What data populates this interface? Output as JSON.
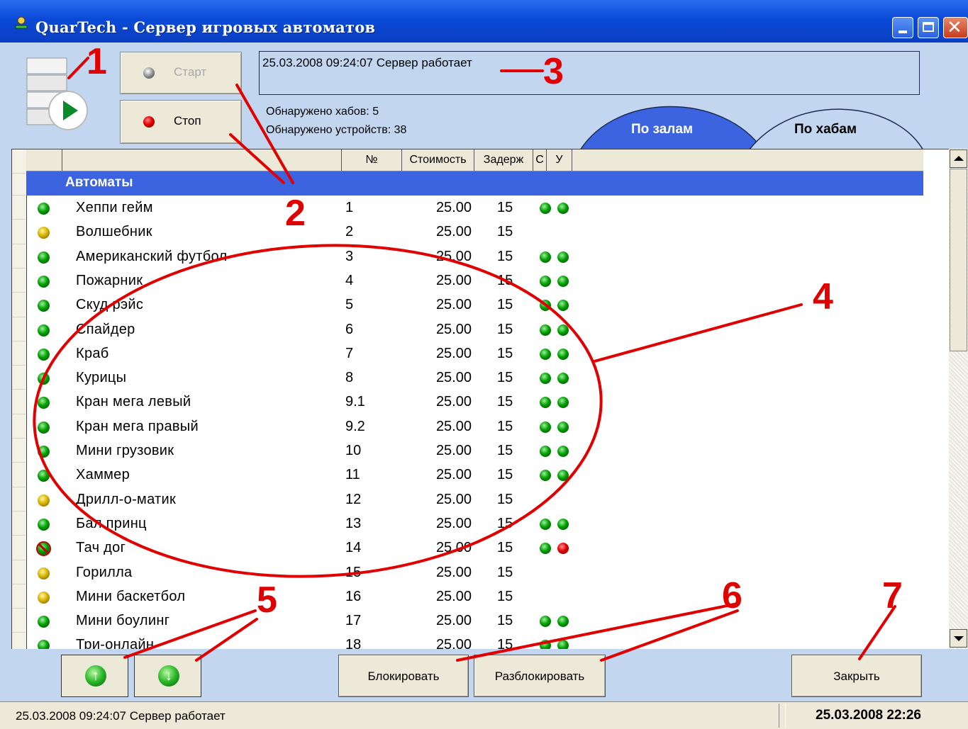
{
  "window": {
    "title": "QuarTech - Сервер игровых автоматов"
  },
  "controls": {
    "start_label": "Старт",
    "stop_label": "Стоп"
  },
  "status": {
    "message": "25.03.2008 09:24:07  Сервер работает"
  },
  "info": {
    "hubs_found": "Обнаружено хабов: 5",
    "devices_found": "Обнаружено устройств: 38"
  },
  "tabs": {
    "halls": "По залам",
    "hubs": "По хабам"
  },
  "table": {
    "headers": {
      "number": "№",
      "cost": "Стоимость",
      "delay": "Задерж",
      "c": "С",
      "u": "У"
    },
    "group": "Автоматы",
    "rows": [
      {
        "status": "green",
        "name": "Хеппи гейм",
        "number": "1",
        "cost": "25.00",
        "delay": "15",
        "c": "ok",
        "u": "ok"
      },
      {
        "status": "yellow",
        "name": "Волшебник",
        "number": "2",
        "cost": "25.00",
        "delay": "15",
        "c": "",
        "u": ""
      },
      {
        "status": "green",
        "name": "Американский футбол",
        "number": "3",
        "cost": "25.00",
        "delay": "15",
        "c": "ok",
        "u": "ok"
      },
      {
        "status": "green",
        "name": "Пожарник",
        "number": "4",
        "cost": "25.00",
        "delay": "15",
        "c": "ok",
        "u": "ok"
      },
      {
        "status": "green",
        "name": "Скуд рэйс",
        "number": "5",
        "cost": "25.00",
        "delay": "15",
        "c": "ok",
        "u": "ok"
      },
      {
        "status": "green",
        "name": "Спайдер",
        "number": "6",
        "cost": "25.00",
        "delay": "15",
        "c": "ok",
        "u": "ok"
      },
      {
        "status": "green",
        "name": "Краб",
        "number": "7",
        "cost": "25.00",
        "delay": "15",
        "c": "ok",
        "u": "ok"
      },
      {
        "status": "green",
        "name": "Курицы",
        "number": "8",
        "cost": "25.00",
        "delay": "15",
        "c": "ok",
        "u": "ok"
      },
      {
        "status": "green",
        "name": "Кран мега левый",
        "number": "9.1",
        "cost": "25.00",
        "delay": "15",
        "c": "ok",
        "u": "ok"
      },
      {
        "status": "green",
        "name": "Кран мега правый",
        "number": "9.2",
        "cost": "25.00",
        "delay": "15",
        "c": "ok",
        "u": "ok"
      },
      {
        "status": "green",
        "name": "Мини грузовик",
        "number": "10",
        "cost": "25.00",
        "delay": "15",
        "c": "ok",
        "u": "ok"
      },
      {
        "status": "green",
        "name": "Хаммер",
        "number": "11",
        "cost": "25.00",
        "delay": "15",
        "c": "ok",
        "u": "ok"
      },
      {
        "status": "yellow",
        "name": "Дрилл-о-матик",
        "number": "12",
        "cost": "25.00",
        "delay": "15",
        "c": "",
        "u": ""
      },
      {
        "status": "green",
        "name": "Бал принц",
        "number": "13",
        "cost": "25.00",
        "delay": "15",
        "c": "ok",
        "u": "ok"
      },
      {
        "status": "blocked",
        "name": "Тач дог",
        "number": "14",
        "cost": "25.00",
        "delay": "15",
        "c": "ok",
        "u": "bad"
      },
      {
        "status": "yellow",
        "name": "Горилла",
        "number": "15",
        "cost": "25.00",
        "delay": "15",
        "c": "",
        "u": ""
      },
      {
        "status": "yellow",
        "name": "Мини баскетбол",
        "number": "16",
        "cost": "25.00",
        "delay": "15",
        "c": "",
        "u": ""
      },
      {
        "status": "green",
        "name": "Мини боулинг",
        "number": "17",
        "cost": "25.00",
        "delay": "15",
        "c": "ok",
        "u": "ok"
      },
      {
        "status": "green",
        "name": "Три-онлайн",
        "number": "18",
        "cost": "25.00",
        "delay": "15",
        "c": "ok",
        "u": "ok"
      }
    ]
  },
  "actions": {
    "block": "Блокировать",
    "unblock": "Разблокировать",
    "close": "Закрыть",
    "move_up_icon": "arrow-up-icon",
    "move_down_icon": "arrow-down-icon"
  },
  "statusbar": {
    "left": "25.03.2008 09:24:07  Сервер работает",
    "right": "25.03.2008  22:26"
  },
  "annotations": [
    "1",
    "2",
    "3",
    "4",
    "5",
    "6",
    "7"
  ],
  "colors": {
    "titlebar": "#0a49d6",
    "group_row": "#3c64e0",
    "annotation": "#e00000",
    "panel": "#c3d6f0"
  }
}
